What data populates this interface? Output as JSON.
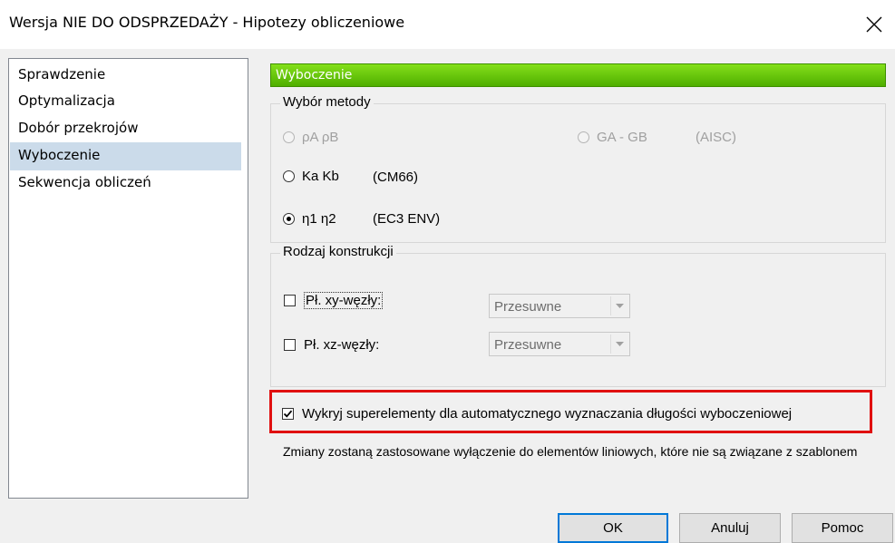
{
  "window": {
    "title": "Wersja NIE DO ODSPRZEDAŻY - Hipotezy obliczeniowe"
  },
  "sidebar": {
    "items": [
      {
        "label": "Sprawdzenie",
        "selected": false
      },
      {
        "label": "Optymalizacja",
        "selected": false
      },
      {
        "label": "Dobór przekrojów",
        "selected": false
      },
      {
        "label": "Wyboczenie",
        "selected": true
      },
      {
        "label": "Sekwencja obliczeń",
        "selected": false
      }
    ]
  },
  "panel": {
    "header": "Wyboczenie",
    "header_color": "#6cc80e",
    "method_group": {
      "label": "Wybór metody",
      "options": [
        {
          "label": "ρA ρB",
          "checked": false,
          "enabled": false
        },
        {
          "label": "GA - GB",
          "extra": "(AISC)",
          "checked": false,
          "enabled": false
        },
        {
          "label": "Ka Kb",
          "extra": "(CM66)",
          "checked": false,
          "enabled": true
        },
        {
          "label": "η1 η2",
          "extra": "(EC3 ENV)",
          "checked": true,
          "enabled": true
        }
      ]
    },
    "structure_group": {
      "label": "Rodzaj konstrukcji",
      "rows": [
        {
          "label": "Pł. xy-węzły:",
          "checked": false,
          "combo_value": "Przesuwne"
        },
        {
          "label": "Pł. xz-węzły:",
          "checked": false,
          "combo_value": "Przesuwne"
        }
      ]
    },
    "superelements": {
      "label": "Wykryj superelementy dla automatycznego wyznaczania długości wyboczeniowej",
      "checked": true,
      "highlight_color": "#e01010"
    },
    "note": "Zmiany zostaną zastosowane wyłączenie do elementów liniowych, które nie są związane z szablonem"
  },
  "buttons": {
    "ok": "OK",
    "cancel": "Anuluj",
    "help": "Pomoc"
  }
}
